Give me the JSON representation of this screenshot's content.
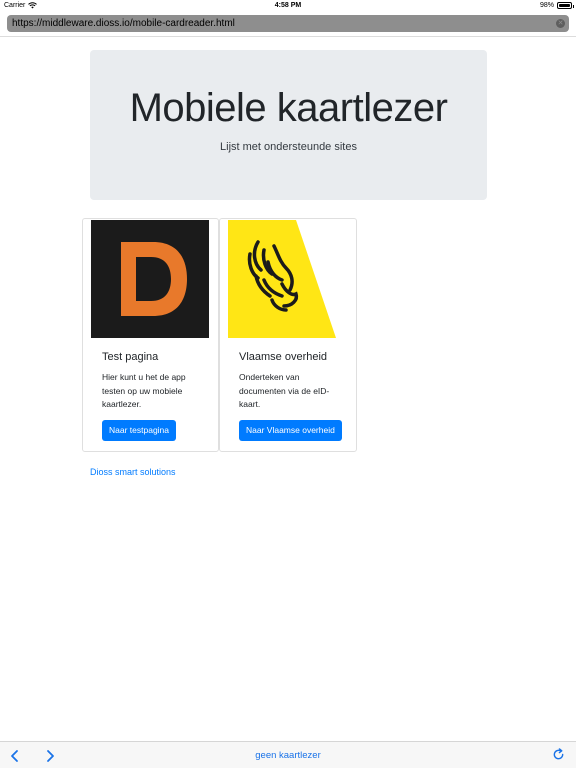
{
  "status_bar": {
    "carrier": "Carrier",
    "time": "4:58 PM",
    "battery_text": "98%",
    "battery_level": 0.98
  },
  "browser": {
    "url": "https://middleware.dioss.io/mobile-cardreader.html",
    "bottom_label": "geen kaartlezer"
  },
  "jumbotron": {
    "title": "Mobiele kaartlezer",
    "lead": "Lijst met ondersteunde sites"
  },
  "cards": [
    {
      "title": "Test pagina",
      "text": "Hier kunt u het de app testen op uw mobiele kaartlezer.",
      "button": "Naar testpagina",
      "logo_color": "#e8792b",
      "logo_bg": "#1b1b1b"
    },
    {
      "title": "Vlaamse overheid",
      "text": "Onderteken van documenten via de eID-kaart.",
      "button": "Naar Vlaamse overheid",
      "logo_color": "#ffe615"
    }
  ],
  "footer": {
    "link": "Dioss smart solutions"
  },
  "colors": {
    "primary": "#007bff",
    "jumbotron_bg": "#e9ecef",
    "ios_blue": "#1a73e8"
  }
}
